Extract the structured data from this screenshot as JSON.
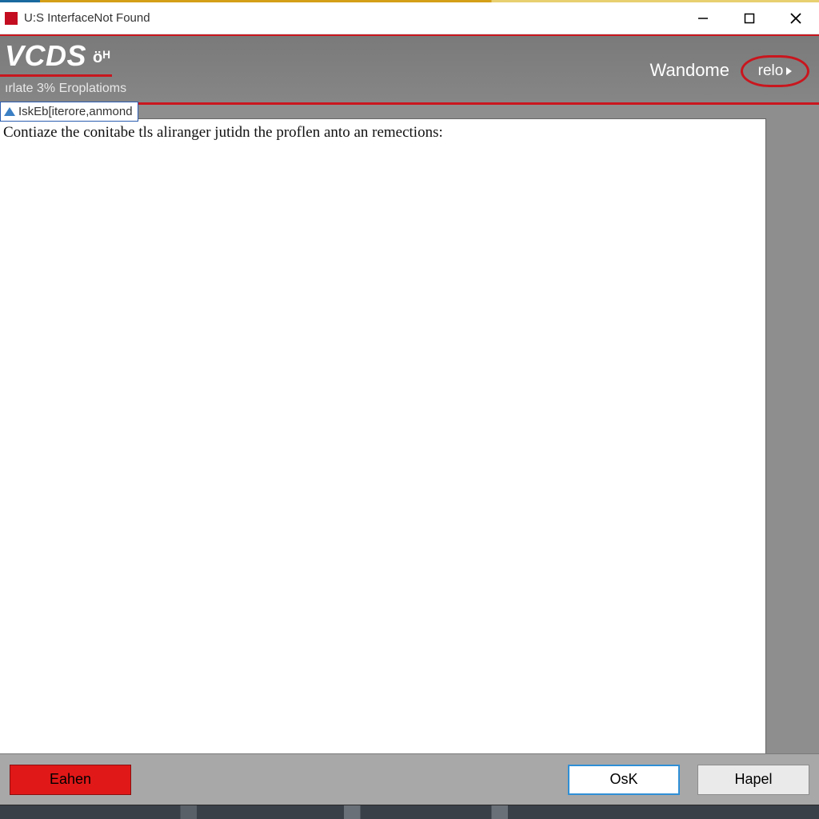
{
  "window": {
    "title": "U:S InterfaceNot Found"
  },
  "banner": {
    "brand": "VCDS",
    "brand_mark": "öᴴ",
    "subtitle": "ırlate 3% Eroplatioms",
    "right_link": "Wandome",
    "relo_label": "relo"
  },
  "tag": {
    "label": "IskEb[iterore,anmond"
  },
  "content": {
    "message": "Contiaze the conitabe tls aliranger jutidn the proflen anto an remections:"
  },
  "footer": {
    "eahen": "Eahen",
    "osk": "OsK",
    "hapel": "Hapel"
  },
  "colors": {
    "accent_red": "#c9161e",
    "banner_gray": "#828282"
  }
}
